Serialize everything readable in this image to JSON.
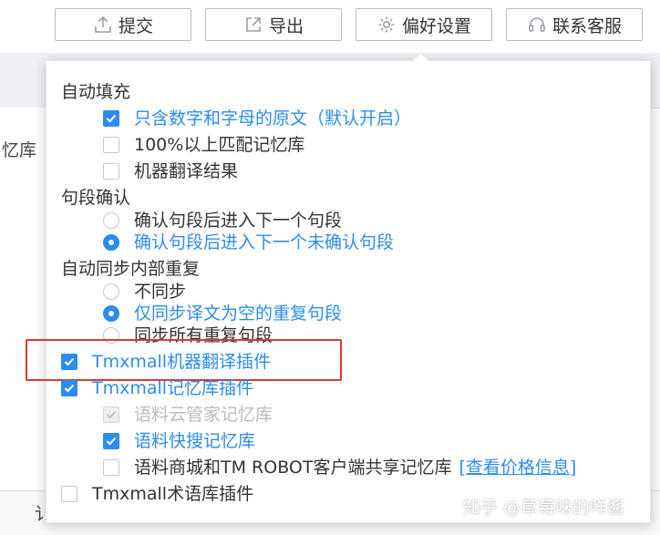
{
  "toolbar": {
    "submit_label": "提交",
    "export_label": "导出",
    "preferences_label": "偏好设置",
    "support_label": "联系客服"
  },
  "background": {
    "left_fragment": "忆库",
    "bottom_fragment": "讠"
  },
  "dropdown": {
    "autofill": {
      "title": "自动填充",
      "options": [
        {
          "label": "只含数字和字母的原文（默认开启）",
          "checked": true
        },
        {
          "label": "100%以上匹配记忆库",
          "checked": false
        },
        {
          "label": "机器翻译结果",
          "checked": false
        }
      ]
    },
    "segment_confirm": {
      "title": "句段确认",
      "options": [
        {
          "label": "确认句段后进入下一个句段",
          "selected": false
        },
        {
          "label": "确认句段后进入下一个未确认句段",
          "selected": true
        }
      ]
    },
    "auto_sync": {
      "title": "自动同步内部重复",
      "options": [
        {
          "label": "不同步",
          "selected": false
        },
        {
          "label": "仅同步译文为空的重复句段",
          "selected": true
        },
        {
          "label": "同步所有重复句段",
          "selected": false
        }
      ]
    },
    "plugins": {
      "mt_plugin": {
        "label": "Tmxmall机器翻译插件",
        "checked": true
      },
      "tm_plugin": {
        "label": "Tmxmall记忆库插件",
        "checked": true
      },
      "tm_sub": [
        {
          "label": "语料云管家记忆库",
          "checked": true,
          "disabled": true
        },
        {
          "label": "语料快搜记忆库",
          "checked": true,
          "disabled": false
        },
        {
          "label": "语料商城和TM ROBOT客户端共享记忆库",
          "checked": false,
          "disabled": false
        }
      ],
      "price_link": "[查看价格信息]",
      "term_plugin": {
        "label": "Tmxmall术语库插件",
        "checked": false
      }
    }
  },
  "watermark": "知乎 @草莓味的咩酱",
  "colors": {
    "accent": "#2d8cf0",
    "highlight_box": "#d93a32"
  }
}
